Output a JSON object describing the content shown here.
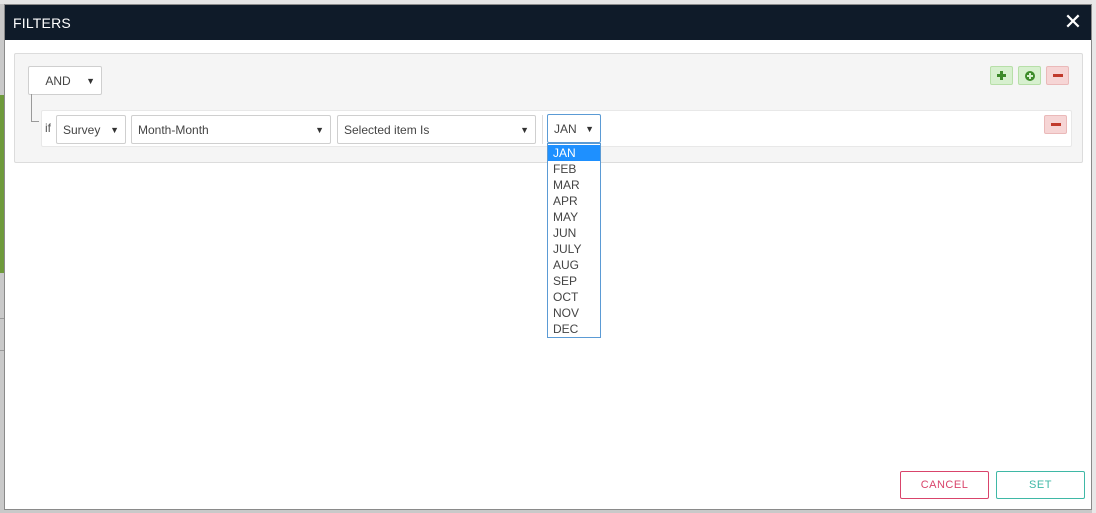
{
  "modal": {
    "title": "FILTERS",
    "close_glyph": "✕"
  },
  "group": {
    "condition": "AND",
    "add_rule_icon": "plus-icon",
    "add_group_icon": "plus-circle-icon",
    "delete_group_icon": "minus-icon"
  },
  "rule": {
    "if_label": "if",
    "source": "Survey",
    "field": "Month-Month",
    "operator": "Selected item Is",
    "value": "JAN",
    "delete_icon": "minus-icon"
  },
  "dropdown": {
    "options": [
      "JAN",
      "FEB",
      "MAR",
      "APR",
      "MAY",
      "JUN",
      "JULY",
      "AUG",
      "SEP",
      "OCT",
      "NOV",
      "DEC"
    ],
    "selected_index": 0
  },
  "footer": {
    "cancel_label": "CANCEL",
    "set_label": "SET"
  },
  "colors": {
    "header_bg": "#0f1b29",
    "accent_blue": "#1e90ff",
    "cancel": "#d9446b",
    "set": "#3fb8a6",
    "add_green": "#3d8b2a",
    "delete_red": "#c0392b"
  }
}
